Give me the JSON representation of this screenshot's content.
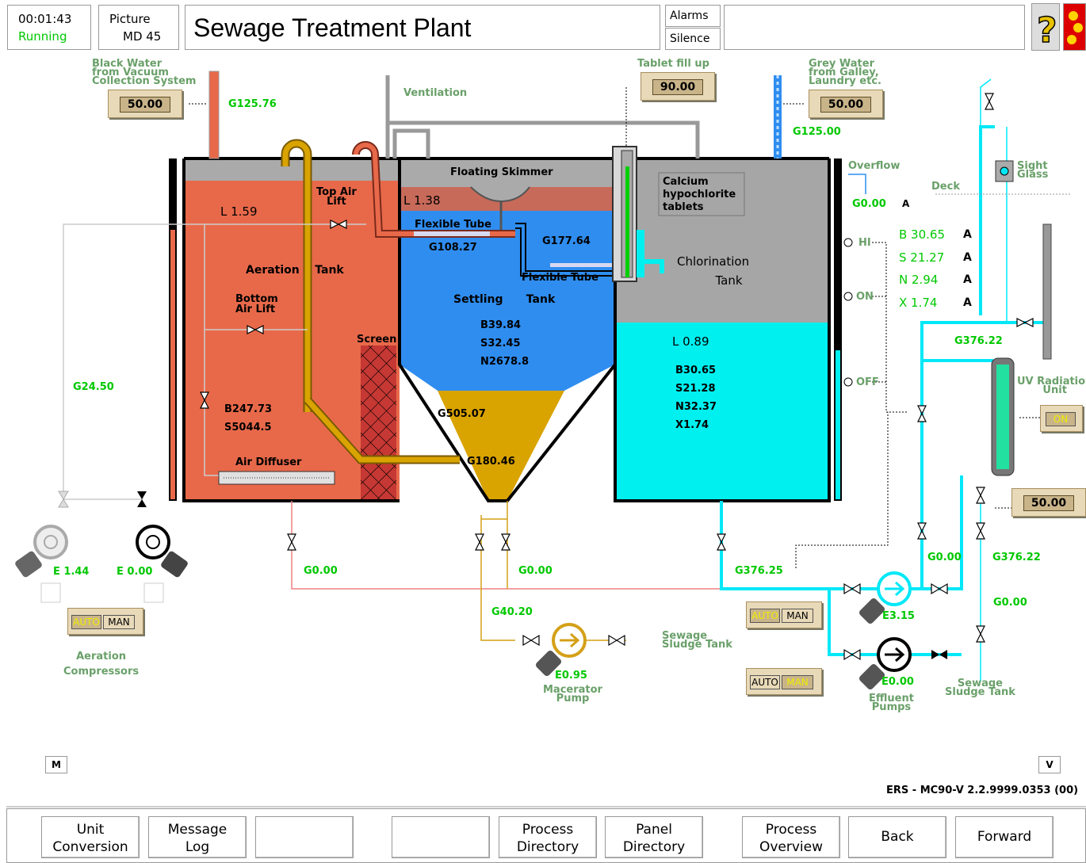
{
  "header": {
    "time": "00:01:43",
    "state": "Running",
    "picture_label": "Picture",
    "picture_id": "MD 45",
    "title": "Sewage Treatment Plant",
    "alarms": "Alarms",
    "silence": "Silence",
    "help_icon": "question-icon",
    "flag_icon": "flag-icon"
  },
  "labels": {
    "black_water": "Black Water\nfrom Vacuum\nCollection System",
    "black_water_1": "Black Water",
    "black_water_2": "from Vacuum",
    "black_water_3": "Collection System",
    "ventilation": "Ventilation",
    "tablet_fill": "Tablet  fill up",
    "grey_water_1": "Grey Water",
    "grey_water_2": "from Galley,",
    "grey_water_3": "Laundry etc.",
    "overflow": "Overflow",
    "deck": "Deck",
    "sight_glass_1": "Sight",
    "sight_glass_2": "Glass",
    "floating_skimmer": "Floating Skimmer",
    "calcium_1": "Calcium",
    "calcium_2": "hypochlorite",
    "calcium_3": "tablets",
    "top_air_lift_1": "Top Air",
    "top_air_lift_2": "Lift",
    "flexible_tube": "Flexible Tube",
    "flexible_tube2": "Flexible Tube",
    "aeration_tank": "Aeration    Tank",
    "settling_tank": "Settling      Tank",
    "chlorination_1": "Chlorination",
    "chlorination_2": "Tank",
    "bottom_air_lift_1": "Bottom",
    "bottom_air_lift_2": "Air Lift",
    "screen": "Screen",
    "air_diffuser": "Air Diffuser",
    "uv_1": "UV Radiation",
    "uv_2": "Unit",
    "aeration_comp_1": "Aeration",
    "aeration_comp_2": "Compressors",
    "sludge_tank_1": "Sewage",
    "sludge_tank_2": "Sludge Tank",
    "sludge_tank_b1": "Sewage",
    "sludge_tank_b2": "Sludge Tank",
    "macerator_1": "Macerator",
    "macerator_2": "Pump",
    "effluent_1": "Effluent",
    "effluent_2": "Pumps",
    "hi": "HI",
    "on": "ON",
    "off": "OFF",
    "version": "ERS - MC90-V 2.2.9999.0353 (00)"
  },
  "values": {
    "g125_76": "G125.76",
    "g125_00": "G125.00",
    "g0_00_overflow": "G0.00",
    "a1": "A",
    "l1_59": "L 1.59",
    "l1_38": "L 1.38",
    "g108_27": "G108.27",
    "g177_64": "G177.64",
    "b30_65": "B 30.65",
    "s21_27": "S 21.27",
    "n2_94": "N 2.94",
    "x1_74": "X 1.74",
    "a2": "A",
    "a3": "A",
    "a4": "A",
    "a5": "A",
    "b39_84": "B39.84",
    "s32_45": "S32.45",
    "n2678_8": "N2678.8",
    "g376_22a": "G376.22",
    "l0_89": "L 0.89",
    "b30_65b": "B30.65",
    "s21_28": "S21.28",
    "n32_37": "N32.37",
    "x1_74b": "X1.74",
    "g24_50": "G24.50",
    "b247_73": "B247.73",
    "s5044_5": "S5044.5",
    "g505_07": "G505.07",
    "g180_46": "G180.46",
    "e1_44": "E 1.44",
    "e0_00a": "E 0.00",
    "g0_00_a": "G0.00",
    "g0_00_b": "G0.00",
    "g376_25": "G376.25",
    "g0_00_c": "G0.00",
    "g376_22b": "G376.22",
    "g40_20": "G40.20",
    "g0_00_d": "G0.00",
    "e3_15": "E3.15",
    "e0_95": "E0.95",
    "e0_00b": "E0.00"
  },
  "setpoints": {
    "black_water": "50.00",
    "tablet": "90.00",
    "grey_water": "50.00",
    "uv_out": "50.00"
  },
  "modes": {
    "aeration": {
      "auto": "AUTO",
      "man": "MAN"
    },
    "effluent1": {
      "auto": "AUTO",
      "man": "MAN"
    },
    "effluent2": {
      "auto": "AUTO",
      "man": "MAN"
    },
    "uv_on": "ON"
  },
  "nav": {
    "m": "M",
    "v": "V"
  },
  "footer": {
    "b1a": "Unit",
    "b1b": "Conversion",
    "b2a": "Message",
    "b2b": "Log",
    "b3a": "",
    "b3b": "",
    "b4a": "",
    "b4b": "",
    "b5a": "Process",
    "b5b": "Directory",
    "b6a": "Panel",
    "b6b": "Directory",
    "b7a": "Process",
    "b7b": "Overview",
    "b8": "Back",
    "b9": "Forward"
  },
  "colors": {
    "aeration": "#e8694a",
    "settling": "#2f8df0",
    "sludge": "#d9a300",
    "chlor_gas": "#a6a6a6",
    "chlor_water": "#00f0f0",
    "cyan_pipe": "#00e8f8",
    "tan": "#d4a017",
    "label_green": "#00c800"
  }
}
